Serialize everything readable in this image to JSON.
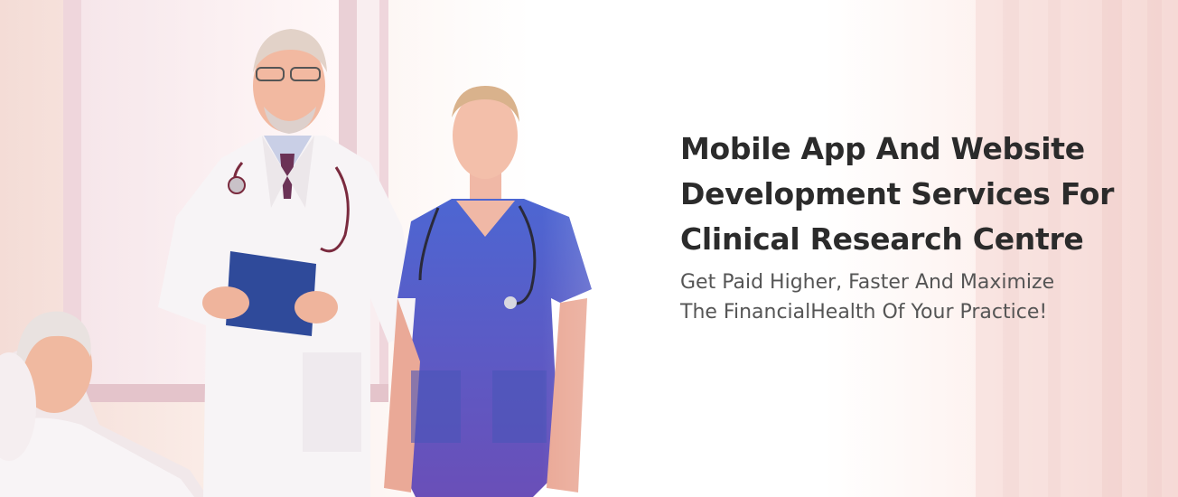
{
  "hero": {
    "title_lines": [
      "Mobile App And Website",
      "Development Services For",
      "Clinical Research Centre"
    ],
    "subtitle_lines": [
      "Get Paid Higher, Faster And Maximize",
      "The FinancialHealth Of Your Practice!"
    ]
  },
  "colors": {
    "title": "#2b2b2b",
    "subtitle": "#555555",
    "scrub_blue": "#4a5fc4",
    "coat_white": "#f7f4f6",
    "tablet_blue": "#2f4a9a",
    "background_pink": "#f7dcd8"
  }
}
